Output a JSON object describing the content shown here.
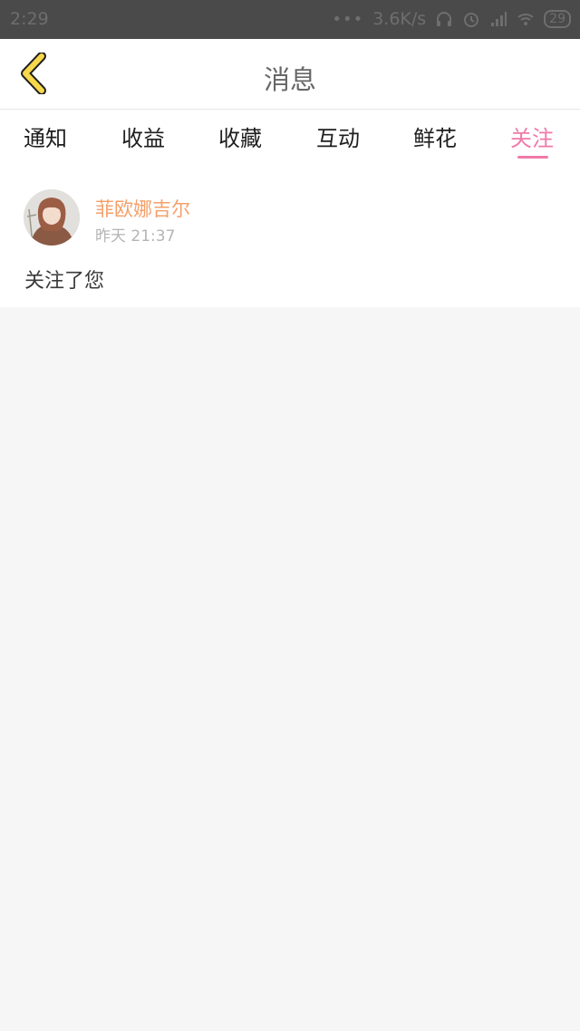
{
  "status_bar": {
    "time": "2:29",
    "dots": "•••",
    "network_speed": "3.6K/s",
    "battery": "29"
  },
  "header": {
    "title": "消息"
  },
  "tabs": [
    {
      "label": "通知"
    },
    {
      "label": "收益"
    },
    {
      "label": "收藏"
    },
    {
      "label": "互动"
    },
    {
      "label": "鲜花"
    },
    {
      "label": "关注",
      "active": true
    }
  ],
  "messages": [
    {
      "username": "菲欧娜吉尔",
      "time": "昨天 21:37",
      "text": "关注了您"
    }
  ],
  "colors": {
    "accent": "#f07aa8",
    "username": "#f4a06a",
    "back_icon": "#f6d84a"
  }
}
